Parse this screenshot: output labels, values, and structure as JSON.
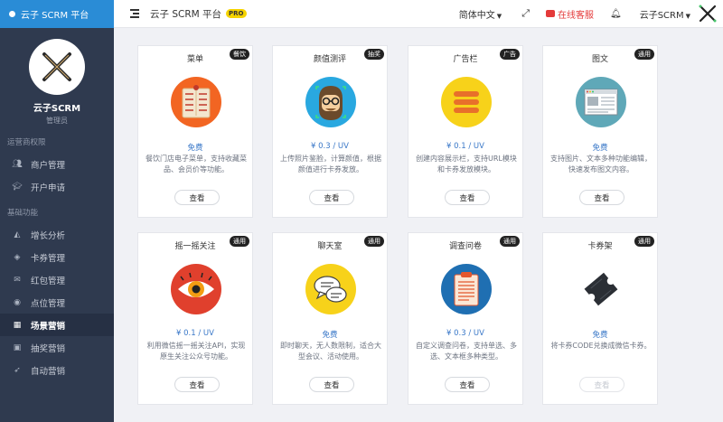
{
  "brand": {
    "title": "云子 SCRM 平台"
  },
  "header": {
    "title": "云子 SCRM 平台",
    "badge": "PRO",
    "language": "简体中文",
    "service": "在线客服",
    "user": "云子SCRM"
  },
  "sidebar": {
    "name": "云子SCRM",
    "role": "管理员",
    "section1": "运营商权限",
    "section2": "基础功能",
    "items": [
      {
        "label": "商户管理",
        "icon": "users-icon"
      },
      {
        "label": "开户申请",
        "icon": "graduation-cap-icon"
      },
      {
        "label": "增长分析",
        "icon": "area-chart-icon"
      },
      {
        "label": "卡券管理",
        "icon": "ticket-icon"
      },
      {
        "label": "红包管理",
        "icon": "envelope-icon"
      },
      {
        "label": "点位管理",
        "icon": "target-icon"
      },
      {
        "label": "场景营销",
        "icon": "grid-icon"
      },
      {
        "label": "抽奖营销",
        "icon": "gamepad-icon"
      },
      {
        "label": "自动营销",
        "icon": "rocket-icon"
      }
    ]
  },
  "cards": [
    {
      "title": "菜单",
      "tag": "餐饮",
      "price": "免费",
      "desc": "餐饮门店电子菜单，支持收藏菜品、会员价等功能。",
      "button": "查看",
      "icon": "menu-board-icon"
    },
    {
      "title": "颜值测评",
      "tag": "抽奖",
      "price": "¥ 0.3 / UV",
      "desc": "上传照片鉴脸，计算颜值，根据颜值进行卡券发放。",
      "button": "查看",
      "icon": "bearded-face-icon"
    },
    {
      "title": "广告栏",
      "tag": "广告",
      "price": "¥ 0.1 / UV",
      "desc": "创建内容展示栏，支持URL模块和卡券发放模块。",
      "button": "查看",
      "icon": "banner-list-icon"
    },
    {
      "title": "图文",
      "tag": "通用",
      "price": "免费",
      "desc": "支持图片、文本多种功能编辑，快速发布图文内容。",
      "button": "查看",
      "icon": "browser-window-icon"
    },
    {
      "title": "摇一摇关注",
      "tag": "通用",
      "price": "¥ 0.1 / UV",
      "desc": "利用微信摇一摇关注API，实现原生关注公众号功能。",
      "button": "查看",
      "icon": "eye-icon"
    },
    {
      "title": "聊天室",
      "tag": "通用",
      "price": "免费",
      "desc": "即时聊天，无人数限制，适合大型会议、活动使用。",
      "button": "查看",
      "icon": "chat-bubbles-icon"
    },
    {
      "title": "调查问卷",
      "tag": "通用",
      "price": "¥ 0.3 / UV",
      "desc": "自定义调查问卷，支持单选、多选、文本框多种类型。",
      "button": "查看",
      "icon": "clipboard-icon"
    },
    {
      "title": "卡券架",
      "tag": "通用",
      "price": "免费",
      "desc": "将卡券CODE兑换成微信卡券。",
      "button": "查看",
      "icon": "ticket-stub-icon",
      "disabled": true
    }
  ]
}
